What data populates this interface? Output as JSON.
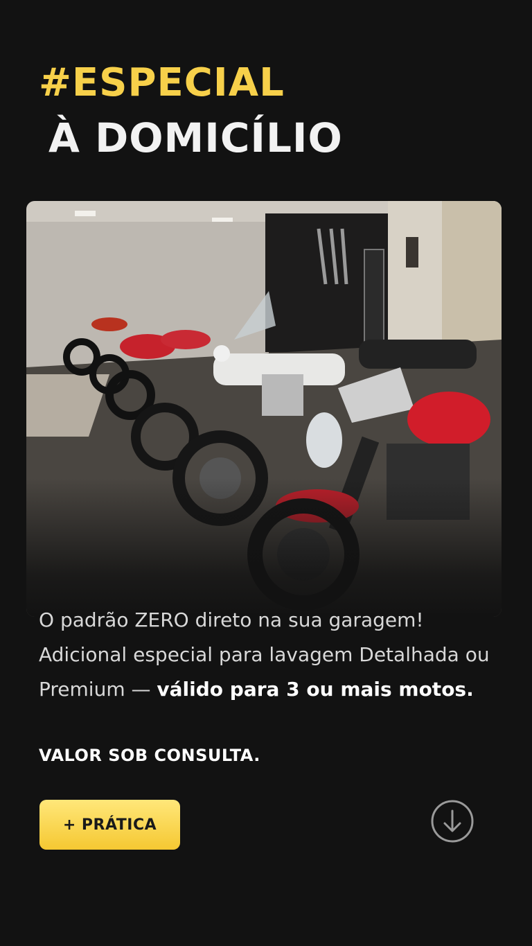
{
  "header": {
    "hashtag": "#ESPECIAL",
    "title": "À DOMICÍLIO"
  },
  "image": {
    "description_icon": "motorcycles-photo"
  },
  "description": {
    "line1": "O padrão ZERO direto na sua garagem!",
    "line2": "Adicional especial para lavagem Detalhada ou",
    "line3_prefix": "Premium — ",
    "line3_bold": "válido para 3 ou mais motos."
  },
  "price_note": "VALOR SOB CONSULTA.",
  "cta": {
    "label": "+ PRÁTICA"
  },
  "scroll_icon": "arrow-down-circle-icon",
  "colors": {
    "background": "#121212",
    "accent": "#f7d04a",
    "cta_bg": "#f5c832",
    "text": "#d8d8d8"
  }
}
